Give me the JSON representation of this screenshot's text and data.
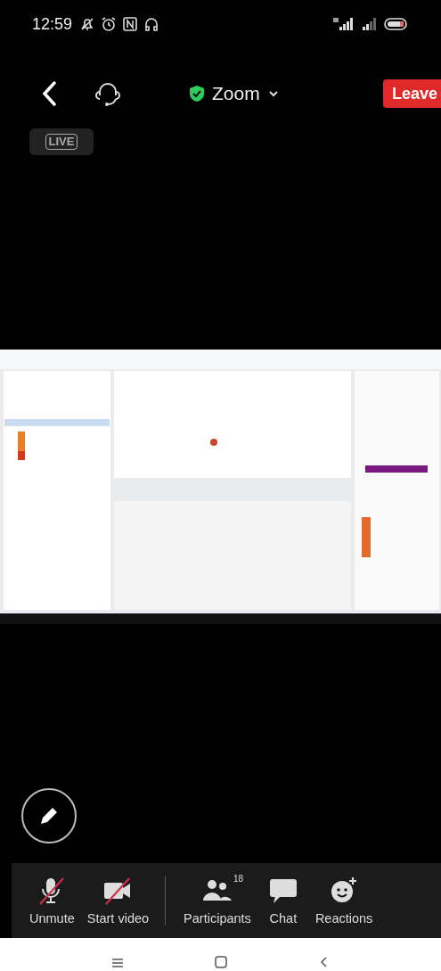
{
  "status_bar": {
    "time": "12:59"
  },
  "top_bar": {
    "title": "Zoom",
    "leave_button": "Leave"
  },
  "live_badge": "LIVE",
  "toolbar": {
    "left": [
      {
        "label": "Unmute",
        "kind": "mic",
        "off": true
      },
      {
        "label": "Start video",
        "kind": "video",
        "off": true
      }
    ],
    "right": [
      {
        "label": "Participants",
        "kind": "people",
        "badge": "18",
        "off": false
      },
      {
        "label": "Chat",
        "kind": "chat",
        "off": false
      },
      {
        "label": "Reactions",
        "kind": "reaction",
        "off": false
      }
    ]
  }
}
